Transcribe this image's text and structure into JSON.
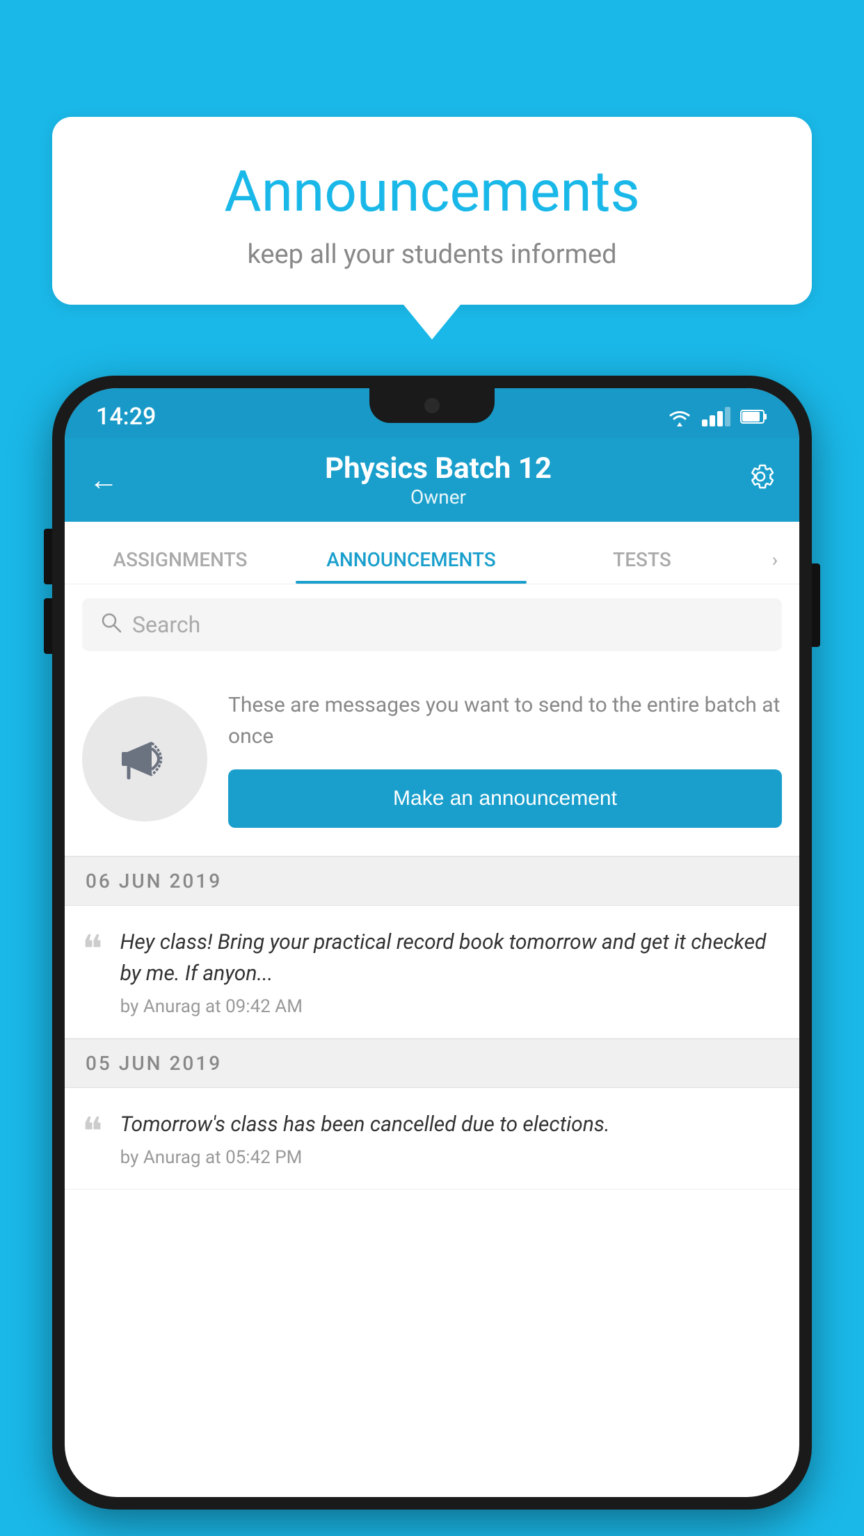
{
  "background_color": "#1ab8e8",
  "bubble": {
    "title": "Announcements",
    "subtitle": "keep all your students informed"
  },
  "status_bar": {
    "time": "14:29",
    "wifi": "▲",
    "battery": "🔋"
  },
  "header": {
    "title": "Physics Batch 12",
    "subtitle": "Owner",
    "back_label": "←",
    "gear_label": "⚙"
  },
  "tabs": [
    {
      "label": "ASSIGNMENTS",
      "active": false
    },
    {
      "label": "ANNOUNCEMENTS",
      "active": true
    },
    {
      "label": "TESTS",
      "active": false
    }
  ],
  "search": {
    "placeholder": "Search"
  },
  "promo": {
    "description": "These are messages you want to send to the entire batch at once",
    "button_label": "Make an announcement"
  },
  "date_groups": [
    {
      "date": "06  JUN  2019",
      "items": [
        {
          "text": "Hey class! Bring your practical record book tomorrow and get it checked by me. If anyon...",
          "author": "by Anurag at 09:42 AM"
        }
      ]
    },
    {
      "date": "05  JUN  2019",
      "items": [
        {
          "text": "Tomorrow's class has been cancelled due to elections.",
          "author": "by Anurag at 05:42 PM"
        }
      ]
    }
  ]
}
